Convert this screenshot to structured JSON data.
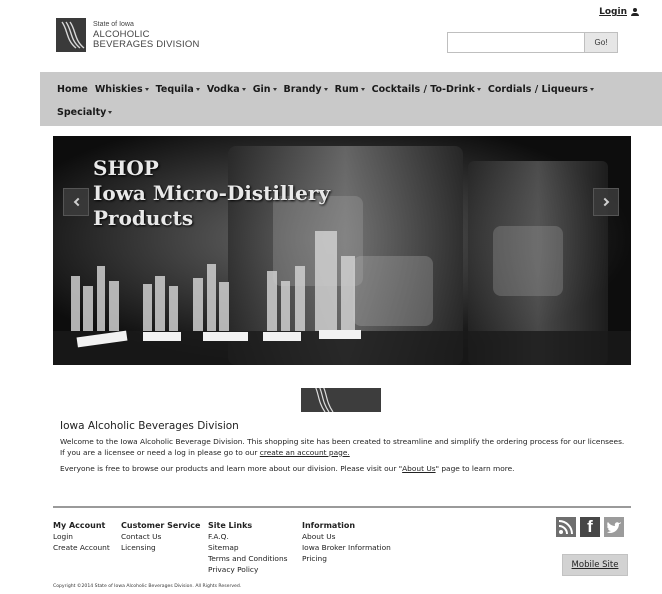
{
  "header": {
    "login_label": "Login",
    "logo": {
      "line1": "State of Iowa",
      "line2": "ALCOHOLIC",
      "line3": "BEVERAGES DIVISION"
    },
    "search": {
      "value": "",
      "placeholder": "",
      "button_label": "Go!"
    }
  },
  "nav": {
    "items": [
      {
        "label": "Home",
        "dropdown": false
      },
      {
        "label": "Whiskies",
        "dropdown": true
      },
      {
        "label": "Tequila",
        "dropdown": true
      },
      {
        "label": "Vodka",
        "dropdown": true
      },
      {
        "label": "Gin",
        "dropdown": true
      },
      {
        "label": "Brandy",
        "dropdown": true
      },
      {
        "label": "Rum",
        "dropdown": true
      },
      {
        "label": "Cocktails / To-Drink",
        "dropdown": true
      },
      {
        "label": "Cordials / Liqueurs",
        "dropdown": true
      },
      {
        "label": "Specialty",
        "dropdown": true
      }
    ]
  },
  "carousel": {
    "title_line1": "SHOP",
    "title_line2": "Iowa Micro-Distillery",
    "title_line3": "Products",
    "prev_icon": "chevron-left-icon",
    "next_icon": "chevron-right-icon"
  },
  "intro": {
    "title": "Iowa Alcoholic Beverages Division",
    "p1_text": "Welcome to the Iowa Alcoholic Beverage Division. This shopping site has been created to streamline and simplify the ordering process for our licensees. If you are a licensee or need a log in please go to our ",
    "p1_link": "create an account page.",
    "p2_text_a": "Everyone is free to browse our products and learn more about our division. Please visit our \"",
    "p2_link": "About Us",
    "p2_text_b": "\" page to learn more."
  },
  "footer": {
    "columns": [
      {
        "heading": "My Account",
        "links": [
          "Login",
          "Create Account"
        ]
      },
      {
        "heading": "Customer Service",
        "links": [
          "Contact Us",
          "Licensing"
        ]
      },
      {
        "heading": "Site Links",
        "links": [
          "F.A.Q.",
          "Sitemap",
          "Terms and Conditions",
          "Privacy Policy"
        ]
      },
      {
        "heading": "Information",
        "links": [
          "About Us",
          "Iowa Broker Information",
          "Pricing"
        ]
      }
    ],
    "social": [
      "rss-icon",
      "facebook-icon",
      "twitter-icon"
    ],
    "mobile_label": "Mobile Site",
    "copyright": "Copyright ©2014 State of Iowa Alcoholic Beverages Division. All Rights Reserved."
  },
  "colors": {
    "nav_bg": "#c9c9c9",
    "carousel_bg": "#0d0d0d",
    "mobile_btn_bg": "#d2d2d2"
  }
}
